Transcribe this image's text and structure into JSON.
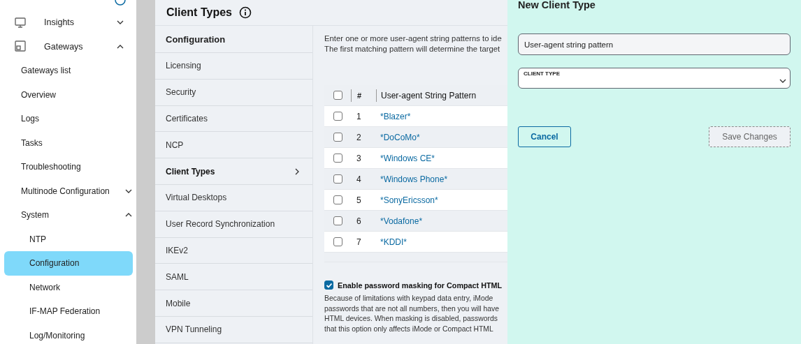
{
  "sidebar": {
    "items": [
      {
        "label": "Insights",
        "expanded": false,
        "selected": false
      },
      {
        "label": "Gateways",
        "expanded": true,
        "selected": false,
        "children": [
          {
            "label": "Gateways list",
            "selected": false
          },
          {
            "label": "Overview",
            "selected": false
          },
          {
            "label": "Logs",
            "selected": false
          },
          {
            "label": "Tasks",
            "selected": false
          },
          {
            "label": "Troubleshooting",
            "selected": false
          },
          {
            "label": "Multinode Configuration",
            "expanded": false,
            "selected": false
          },
          {
            "label": "System",
            "expanded": true,
            "selected": false,
            "children": [
              {
                "label": "NTP",
                "selected": false
              },
              {
                "label": "Configuration",
                "selected": true
              },
              {
                "label": "Network",
                "selected": false
              },
              {
                "label": "IF-MAP Federation",
                "selected": false
              },
              {
                "label": "Log/Monitoring",
                "selected": false
              }
            ]
          }
        ]
      }
    ]
  },
  "page": {
    "title": "Client Types",
    "nav": {
      "heading": "Configuration",
      "items": [
        {
          "label": "Licensing",
          "selected": false
        },
        {
          "label": "Security",
          "selected": false
        },
        {
          "label": "Certificates",
          "selected": false
        },
        {
          "label": "NCP",
          "selected": false
        },
        {
          "label": "Client Types",
          "selected": true
        },
        {
          "label": "Virtual Desktops",
          "selected": false
        },
        {
          "label": "User Record Synchronization",
          "selected": false
        },
        {
          "label": "IKEv2",
          "selected": false
        },
        {
          "label": "SAML",
          "selected": false
        },
        {
          "label": "Mobile",
          "selected": false
        },
        {
          "label": "VPN Tunneling",
          "selected": false
        }
      ]
    },
    "intro": [
      "Enter one or more user-agent string patterns to ide",
      "The first matching pattern will determine the target"
    ],
    "table": {
      "columns": [
        "#",
        "User-agent String Pattern"
      ],
      "all_checked": false,
      "rows": [
        {
          "number": "1",
          "pattern": "*Blazer*",
          "checked": false
        },
        {
          "number": "2",
          "pattern": "*DoCoMo*",
          "checked": false
        },
        {
          "number": "3",
          "pattern": "*Windows CE*",
          "checked": false
        },
        {
          "number": "4",
          "pattern": "*Windows Phone*",
          "checked": false
        },
        {
          "number": "5",
          "pattern": "*SonyEricsson*",
          "checked": false
        },
        {
          "number": "6",
          "pattern": "*Vodafone*",
          "checked": false
        },
        {
          "number": "7",
          "pattern": "*KDDI*",
          "checked": false
        }
      ]
    },
    "masking": {
      "label": "Enable password masking for Compact HTML",
      "checked": true,
      "description": [
        "Because of limitations with keypad data entry, iMode",
        "passwords that are not all numbers, then you will have",
        "HTML devices. When masking is disabled, passwords",
        "that this option only affects iMode or Compact HTML"
      ]
    }
  },
  "panel": {
    "title": "New Client Type",
    "pattern_field": {
      "placeholder": "User-agent string pattern"
    },
    "client_type": {
      "label": "CLIENT TYPE"
    },
    "buttons": [
      {
        "label": "Cancel",
        "disabled": false
      },
      {
        "label": "Save Changes",
        "disabled": true
      }
    ]
  }
}
